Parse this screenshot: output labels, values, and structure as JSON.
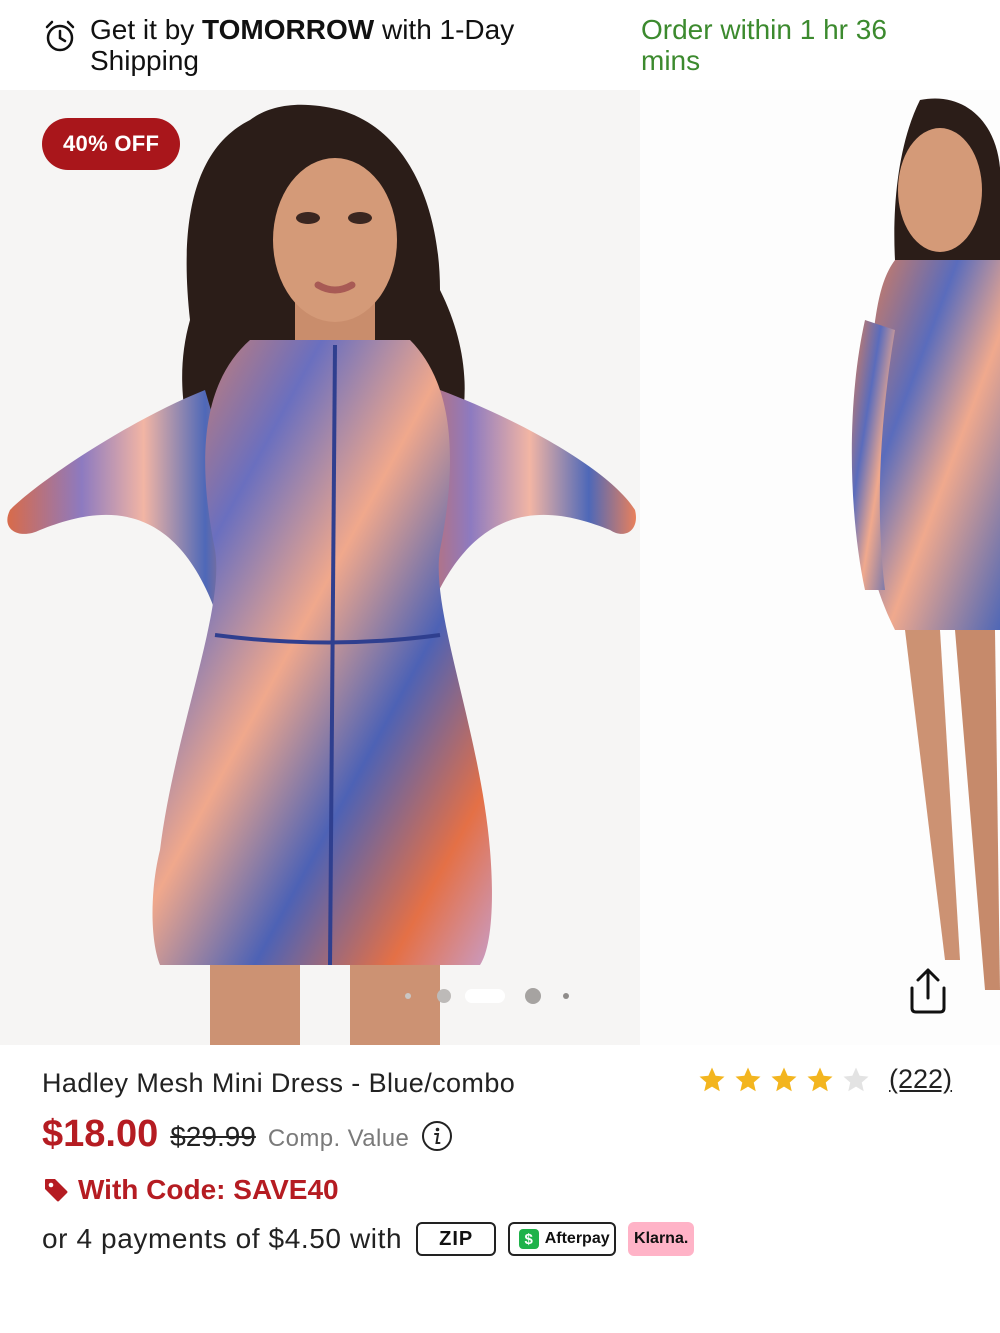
{
  "shipping": {
    "prefix": "Get it by ",
    "highlight": "TOMORROW",
    "suffix": " with 1-Day Shipping",
    "cutoff": "Order within 1 hr 36 mins"
  },
  "gallery": {
    "badge": "40% OFF",
    "dots_count": 5,
    "active_dot": 3,
    "main_image_alt": "Model wearing multicolor mesh mini dress, front view",
    "next_image_alt": "Model wearing multicolor mesh mini dress, side view"
  },
  "product": {
    "title": "Hadley Mesh Mini Dress - Blue/combo",
    "rating": 4,
    "rating_max": 5,
    "review_count": "(222)",
    "price": "$18.00",
    "original_price": "$29.99",
    "comp_label": "Comp. Value",
    "promo": "With Code: SAVE40",
    "installments": "or 4 payments of $4.50 with",
    "payment_providers": {
      "zip": "ZIP",
      "afterpay": "Afterpay",
      "klarna": "Klarna."
    }
  },
  "colors": {
    "accent_red": "#b51c22",
    "badge_red": "#a9161b",
    "green": "#3c8a2e",
    "star": "#f3b51f"
  }
}
